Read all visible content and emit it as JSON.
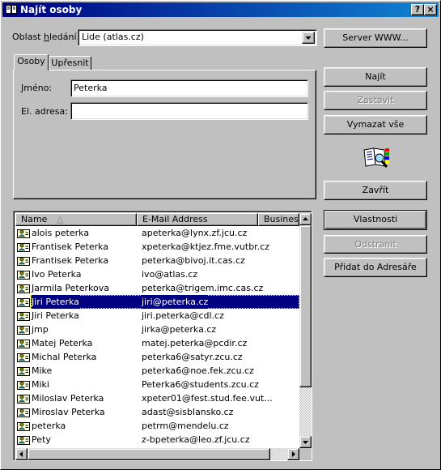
{
  "window": {
    "title": "Najít osoby",
    "help_button": "?",
    "close_button": "×"
  },
  "search_scope": {
    "label_prefix": "Oblast ",
    "label_accel": "h",
    "label_suffix": "ledání:",
    "value": "Lide (atlas.cz)"
  },
  "buttons": {
    "server_www": "Server WWW...",
    "find": "Najít",
    "stop": "Zastavit",
    "clear_all": "Vymazat vše",
    "close": "Zavřít",
    "properties": "Vlastnosti",
    "delete": "Odstranit",
    "add_to_address_book": "Přidat do Adresáře"
  },
  "tabs": [
    {
      "label": "Osoby",
      "active": true
    },
    {
      "label": "Upřesnit",
      "active": false
    }
  ],
  "form": {
    "name_label": "Jméno:",
    "name_value": "Peterka",
    "email_label": "El. adresa:",
    "email_value": ""
  },
  "results": {
    "columns": [
      "Name",
      "E-Mail Address",
      "Business"
    ],
    "sort_indicator": "△",
    "rows": [
      {
        "name": "alois peterka",
        "email": "apeterka@lynx.zf.jcu.cz"
      },
      {
        "name": "Frantisek Peterka",
        "email": "xpeterka@ktjez.fme.vutbr.cz"
      },
      {
        "name": "Frantisek Peterka",
        "email": "peterka@bivoj.it.cas.cz"
      },
      {
        "name": "Ivo Peterka",
        "email": "ivo@atlas.cz"
      },
      {
        "name": "Jarmila Peterkova",
        "email": "peterka@trigem.imc.cas.cz"
      },
      {
        "name": "Jiri Peterka",
        "email": "jiri@peterka.cz",
        "selected": true
      },
      {
        "name": "Jiri Peterka",
        "email": "jiri.peterka@cdl.cz"
      },
      {
        "name": "jmp",
        "email": "jirka@peterka.cz"
      },
      {
        "name": "Matej Peterka",
        "email": "matej.peterka@pcdir.cz"
      },
      {
        "name": "Michal Peterka",
        "email": "peterka6@satyr.zcu.cz"
      },
      {
        "name": "Mike",
        "email": "peterka6@noe.fek.zcu.cz"
      },
      {
        "name": "Miki",
        "email": "Peterka6@students.zcu.cz"
      },
      {
        "name": "Miloslav Peterka",
        "email": "xpeter01@fest.stud.fee.vut..."
      },
      {
        "name": "Miroslav Peterka",
        "email": "adast@sisblansko.cz"
      },
      {
        "name": "peterka",
        "email": "petrm@mendelu.cz"
      },
      {
        "name": "Pety",
        "email": "z-bpeterka@leo.zf.jcu.cz"
      }
    ]
  },
  "colors": {
    "titlebar": "#000080",
    "selection": "#000080",
    "face": "#c0c0c0"
  }
}
